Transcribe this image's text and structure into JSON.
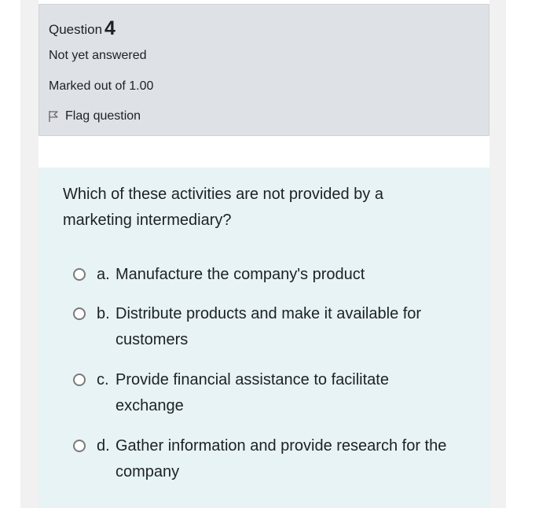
{
  "question": {
    "label": "Question",
    "number": "4",
    "state": "Not yet answered",
    "grade": "Marked out of 1.00",
    "flag_label": "Flag question",
    "text": "Which of these activities are not provided by a marketing intermediary?",
    "options": [
      {
        "letter": "a.",
        "text": "Manufacture the company's product"
      },
      {
        "letter": "b.",
        "text": "Distribute products and make it available for customers"
      },
      {
        "letter": "c.",
        "text": "Provide financial assistance to facilitate exchange"
      },
      {
        "letter": "d.",
        "text": "Gather information and provide research for the company"
      }
    ]
  },
  "colors": {
    "info_background": "#dee2e6",
    "question_background": "#e7f3f5",
    "radio_border": "#7a7a7a",
    "text": "#1d2125"
  },
  "icons": {
    "flag": "flag-icon",
    "radio": "radio-unselected-icon"
  }
}
